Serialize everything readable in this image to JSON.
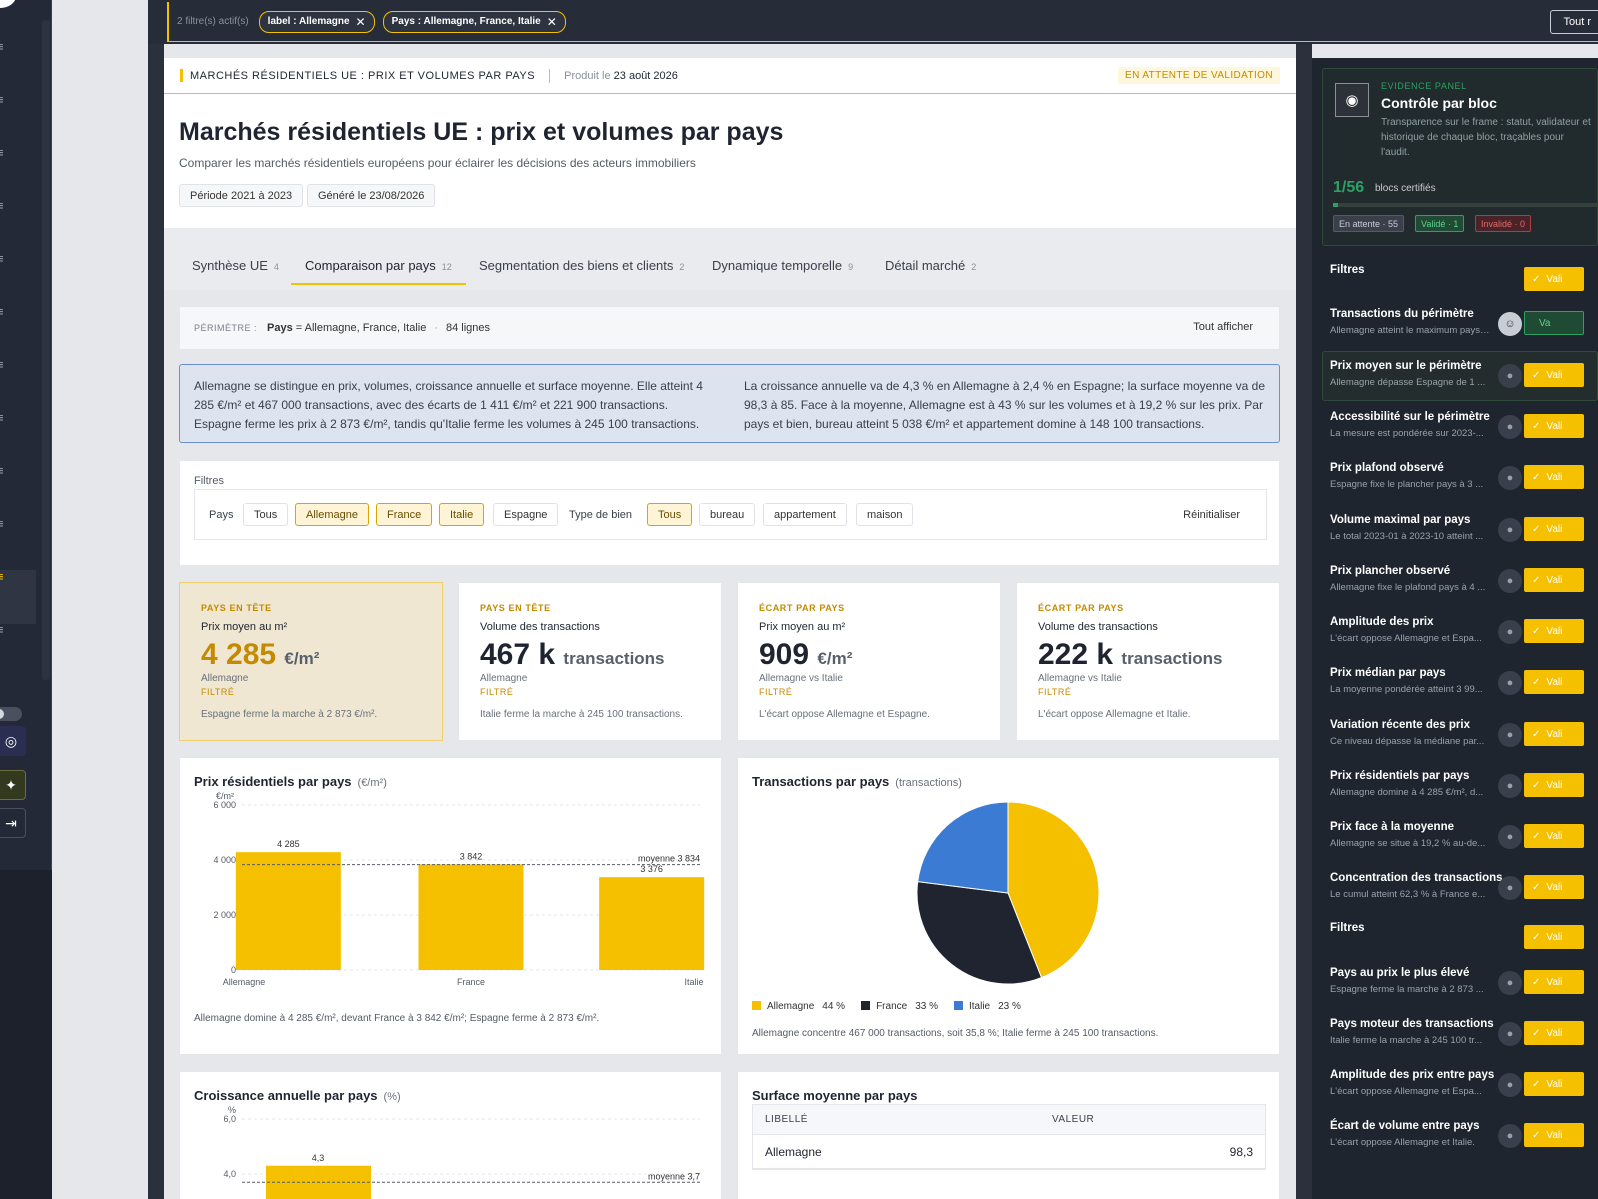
{
  "filterbar": {
    "count_label": "2 filtre(s) actif(s)",
    "chips": [
      "label : Allemagne",
      "Pays : Allemagne, France, Italie"
    ],
    "clear_all": "Tout r"
  },
  "report": {
    "strip_title": "MARCHÉS RÉSIDENTIELS UE : PRIX ET VOLUMES PAR PAYS",
    "produced_prefix": "Produit le",
    "produced_date": "23 août 2026",
    "status": "EN ATTENTE DE VALIDATION",
    "title": "Marchés résidentiels UE : prix et volumes par pays",
    "subtitle": "Comparer les marchés résidentiels européens pour éclairer les décisions des acteurs immobiliers",
    "pills": [
      "Période 2021 à 2023",
      "Généré le 23/08/2026"
    ]
  },
  "tabs": [
    {
      "label": "Synthèse UE",
      "count": "4"
    },
    {
      "label": "Comparaison par pays",
      "count": "12"
    },
    {
      "label": "Segmentation des biens et clients",
      "count": "2"
    },
    {
      "label": "Dynamique temporelle",
      "count": "9"
    },
    {
      "label": "Détail marché",
      "count": "2"
    }
  ],
  "perimeter": {
    "label": "PÉRIMÈTRE :",
    "field": "Pays",
    "value": "= Allemagne, France, Italie",
    "rows": "84 lignes",
    "show_all": "Tout afficher"
  },
  "narrative": {
    "left": "Allemagne se distingue en prix, volumes, croissance annuelle et surface moyenne. Elle atteint 4 285 €/m² et 467 000 transactions, avec des écarts de 1 411 €/m² et 221 900 transactions. Espagne ferme les prix à 2 873 €/m², tandis qu'Italie ferme les volumes à 245 100 transactions.",
    "right": "La croissance annuelle va de 4,3 % en Allemagne à 2,4 % en Espagne; la surface moyenne va de 98,3 à 85. Face à la moyenne, Allemagne est à 43 % sur les volumes et à 19,2 % sur les prix. Par pays et bien, bureau atteint 5 038 €/m² et appartement domine à 148 100 transactions."
  },
  "filters": {
    "title": "Filtres",
    "pays_label": "Pays",
    "pays": [
      "Tous",
      "Allemagne",
      "France",
      "Italie",
      "Espagne"
    ],
    "type_label": "Type de bien",
    "types": [
      "Tous",
      "bureau",
      "appartement",
      "maison"
    ],
    "reset": "Réinitialiser"
  },
  "kpis": [
    {
      "tag": "PAYS EN TÊTE",
      "label": "Prix moyen au m²",
      "value": "4 285",
      "unit": "€/m²",
      "sub": "Allemagne",
      "flag": "FILTRÉ",
      "note": "Espagne ferme la marche à 2 873 €/m²."
    },
    {
      "tag": "PAYS EN TÊTE",
      "label": "Volume des transactions",
      "value": "467 k",
      "unit": "transactions",
      "sub": "Allemagne",
      "flag": "FILTRÉ",
      "note": "Italie ferme la marche à 245 100 transactions."
    },
    {
      "tag": "ÉCART PAR PAYS",
      "label": "Prix moyen au m²",
      "value": "909",
      "unit": "€/m²",
      "sub": "Allemagne vs Italie",
      "flag": "FILTRÉ",
      "note": "L'écart oppose Allemagne et Espagne."
    },
    {
      "tag": "ÉCART PAR PAYS",
      "label": "Volume des transactions",
      "value": "222 k",
      "unit": "transactions",
      "sub": "Allemagne vs Italie",
      "flag": "FILTRÉ",
      "note": "L'écart oppose Allemagne et Italie."
    }
  ],
  "charts_text": {
    "bar_title": "Prix résidentiels par pays",
    "bar_unit": "(€/m²)",
    "bar_note": "Allemagne domine à 4 285 €/m², devant France à 3 842 €/m²; Espagne ferme à 2 873 €/m².",
    "pie_title": "Transactions par pays",
    "pie_unit": "(transactions)",
    "pie_note": "Allemagne concentre 467 000 transactions, soit 35,8 %; Italie ferme à 245 100 transactions.",
    "growth_title": "Croissance annuelle par pays",
    "growth_unit": "(%)",
    "surface_title": "Surface moyenne par pays",
    "table_headers": [
      "LIBELLÉ",
      "VALEUR"
    ],
    "table_rows": [
      [
        "Allemagne",
        "98,3"
      ]
    ]
  },
  "chart_data": [
    {
      "type": "bar",
      "title": "Prix résidentiels par pays",
      "ylabel": "€/m²",
      "categories": [
        "Allemagne",
        "France",
        "Italie"
      ],
      "values": [
        4285,
        3842,
        3376
      ],
      "value_labels": [
        "4 285",
        "3 842",
        "3 376"
      ],
      "ylim": [
        0,
        6000
      ],
      "yticks": [
        "0",
        "2 000",
        "4 000",
        "6 000"
      ],
      "reference": {
        "label": "moyenne 3 834",
        "value": 3834
      },
      "color": "#f5c000",
      "grid": true
    },
    {
      "type": "pie",
      "title": "Transactions par pays",
      "categories": [
        "Allemagne",
        "France",
        "Italie"
      ],
      "values": [
        44,
        33,
        23
      ],
      "labels": [
        "44 %",
        "33 %",
        "23 %"
      ],
      "colors": [
        "#f5c000",
        "#1f2430",
        "#3b7bd4"
      ],
      "legend": "bottom"
    },
    {
      "type": "bar",
      "title": "Croissance annuelle par pays",
      "ylabel": "%",
      "categories": [
        "Allemagne"
      ],
      "values": [
        4.3
      ],
      "value_labels": [
        "4,3"
      ],
      "ylim": [
        0,
        6.0
      ],
      "yticks": [
        "4,0",
        "6,0"
      ],
      "reference": {
        "label": "moyenne 3,7",
        "value": 3.7
      },
      "color": "#f5c000"
    }
  ],
  "panel": {
    "tag": "EVIDENCE PANEL",
    "title": "Contrôle par bloc",
    "desc": "Transparence sur le frame : statut, validateur et historique de chaque bloc, traçables pour l'audit.",
    "count": "1/56",
    "count_label": "blocs certifiés",
    "progress": 0.018,
    "statuses": [
      "En attente · 55",
      "Validé · 1",
      "Invalidé · 0"
    ],
    "validate_label": "Vali",
    "validated_label": "Va",
    "items": [
      {
        "title": "Filtres",
        "desc": ""
      },
      {
        "title": "Transactions du périmètre",
        "desc": "Allemagne atteint le maximum pays avec..."
      },
      {
        "title": "Prix moyen sur le périmètre",
        "desc": "Allemagne dépasse Espagne de 1 ..."
      },
      {
        "title": "Accessibilité sur le périmètre",
        "desc": "La mesure est pondérée sur 2023-..."
      },
      {
        "title": "Prix plafond observé",
        "desc": "Espagne fixe le plancher pays à 3 ..."
      },
      {
        "title": "Volume maximal par pays",
        "desc": "Le total 2023-01 à 2023-10 atteint ..."
      },
      {
        "title": "Prix plancher observé",
        "desc": "Allemagne fixe le plafond pays à 4 ..."
      },
      {
        "title": "Amplitude des prix",
        "desc": "L'écart oppose Allemagne et Espa..."
      },
      {
        "title": "Prix médian par pays",
        "desc": "La moyenne pondérée atteint 3 99..."
      },
      {
        "title": "Variation récente des prix",
        "desc": "Ce niveau dépasse la médiane par..."
      },
      {
        "title": "Prix résidentiels par pays",
        "desc": "Allemagne domine à 4 285 €/m², d..."
      },
      {
        "title": "Prix face à la moyenne",
        "desc": "Allemagne se situe à 19,2 % au-de..."
      },
      {
        "title": "Concentration des transactions",
        "desc": "Le cumul atteint 62,3 % à France e..."
      },
      {
        "title": "Filtres",
        "desc": ""
      },
      {
        "title": "Pays au prix le plus élevé",
        "desc": "Espagne ferme la marche à 2 873 ..."
      },
      {
        "title": "Pays moteur des transactions",
        "desc": "Italie ferme la marche à 245 100 tr..."
      },
      {
        "title": "Amplitude des prix entre pays",
        "desc": "L'écart oppose Allemagne et Espa..."
      },
      {
        "title": "Écart de volume entre pays",
        "desc": "L'écart oppose Allemagne et Italie."
      }
    ]
  }
}
